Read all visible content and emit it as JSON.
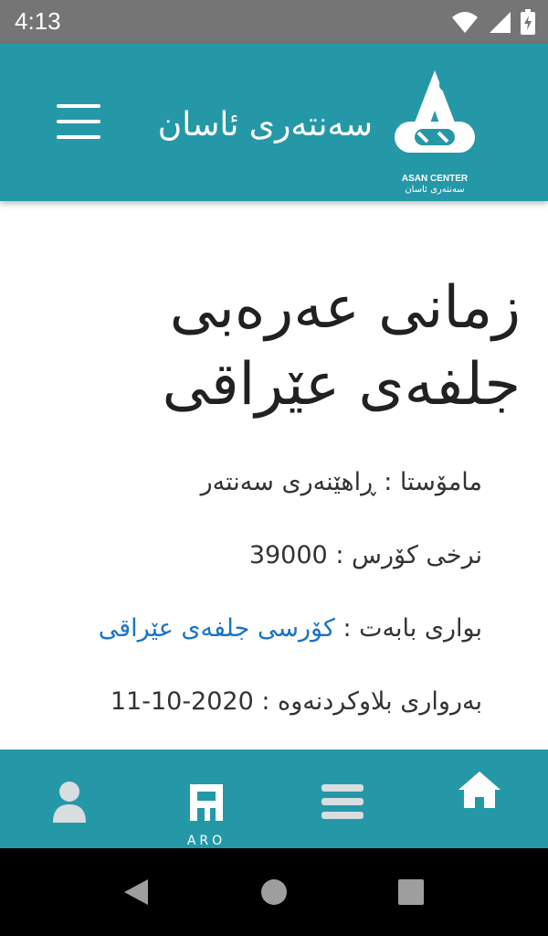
{
  "status_bar": {
    "time": "4:13",
    "icons": [
      "wifi-icon",
      "signal-icon",
      "battery-icon"
    ]
  },
  "header": {
    "title": "سەنتەری ئاسان",
    "logo_text_en": "ASAN CENTER",
    "logo_text_ku": "سەنتەری ئاسان"
  },
  "article": {
    "title_line1": "زمانی عەرەبی",
    "title_line2": "جلفەی عێراقی",
    "teacher_label": "مامۆستا :",
    "teacher_value": "ڕاهێنەری سەنتەر",
    "price_label": "نرخی کۆرس :",
    "price_value": "39000",
    "topic_label": "بواری بابەت :",
    "topic_link": "کۆرسی جلفەی عێراقی",
    "date_label": "بەرواری بلاوکردنەوە :",
    "date_value": "11-10-2020"
  },
  "bottom_nav": {
    "items": [
      "home-icon",
      "list-icon",
      "aro-logo-icon",
      "user-icon"
    ],
    "aro_text": "ARO"
  },
  "colors": {
    "primary": "#2598a8",
    "link": "#1a73c9",
    "status_bar": "#757575"
  }
}
